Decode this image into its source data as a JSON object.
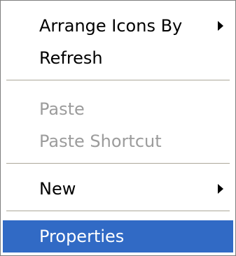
{
  "context_menu": {
    "items": [
      {
        "label": "Arrange Icons By"
      },
      {
        "label": "Refresh"
      },
      {
        "label": "Paste"
      },
      {
        "label": "Paste Shortcut"
      },
      {
        "label": "New"
      },
      {
        "label": "Properties"
      }
    ]
  },
  "colors": {
    "highlight": "#316ac5",
    "disabled_text": "#9c9c9c",
    "separator": "#aca899"
  }
}
